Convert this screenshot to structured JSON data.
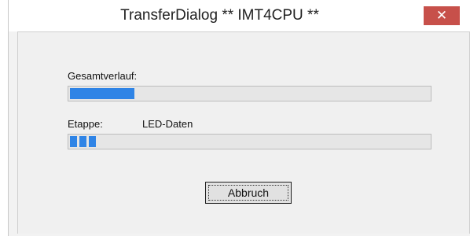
{
  "window": {
    "title": "TransferDialog ** IMT4CPU **",
    "close_glyph": "✕"
  },
  "overall": {
    "label": "Gesamtverlauf:",
    "progress_percent": 18
  },
  "stage": {
    "label": "Etappe:",
    "value": "LED-Daten",
    "progress_blocks": 3
  },
  "buttons": {
    "abort_label": "Abbruch"
  },
  "colors": {
    "progress": "#2f84e6",
    "close_button": "#c7504a"
  }
}
